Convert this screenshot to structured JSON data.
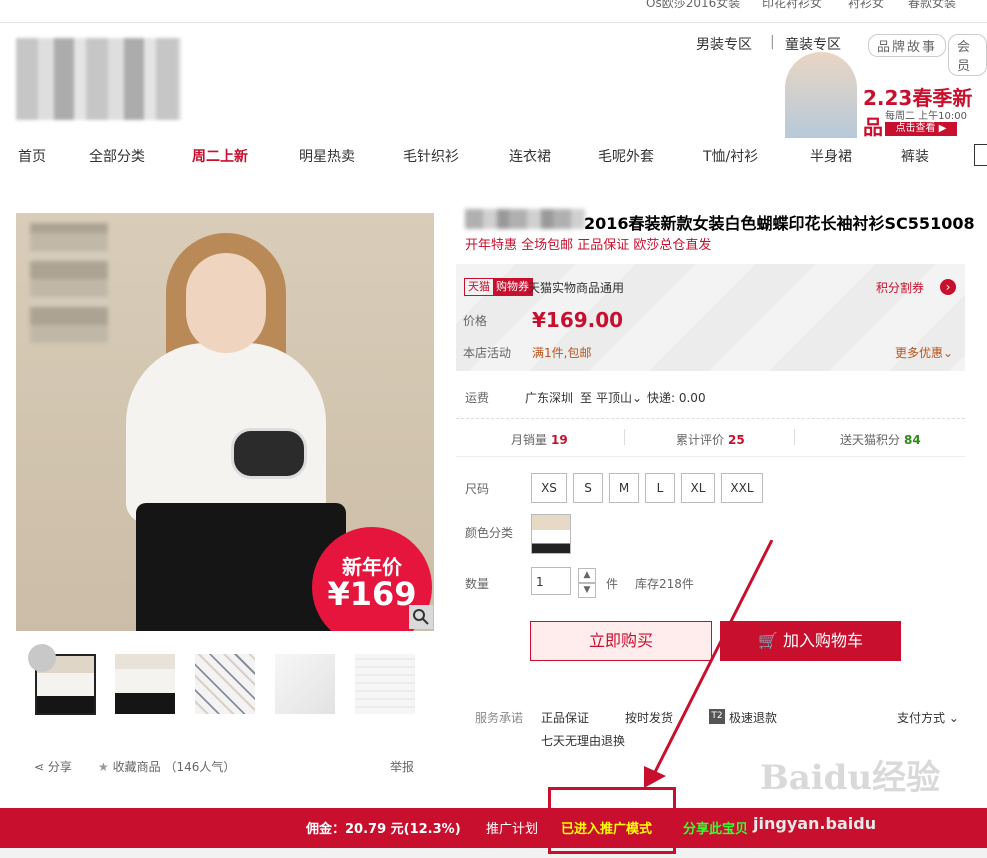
{
  "top_links": [
    "Os欧莎2016女装",
    "印花衬衫女",
    "衬衫女",
    "春款女装"
  ],
  "header": {
    "men_zone": "男装专区",
    "separator": "|",
    "kids_zone": "童装专区",
    "brand_story": "品牌故事",
    "member": "会员"
  },
  "banner": {
    "title": "2.23春季新品",
    "subtitle": "每周二 上午10:00",
    "button": "点击查看 ▶"
  },
  "nav": [
    "首页",
    "全部分类",
    "周二上新",
    "明星热卖",
    "毛针织衫",
    "连衣裙",
    "毛呢外套",
    "T恤/衬衫",
    "半身裙",
    "裤装"
  ],
  "nav_active_index": 2,
  "product": {
    "title": "2016春装新款女装白色蝴蝶印花长袖衬衫SC551008",
    "subtitle": "开年特惠 全场包邮 正品保证 欧莎总仓直发",
    "image_badge_label": "新年价",
    "image_badge_price": "¥169"
  },
  "price_panel": {
    "tmall": "天猫",
    "coupon": "购物券",
    "coupon_desc": "天猫实物商品通用",
    "points": "积分割券",
    "points_arrow": "›",
    "price_label": "价格",
    "price": "¥169.00",
    "promo_label": "本店活动",
    "promo_value": "满1件,包邮",
    "more_offers": "更多优惠"
  },
  "shipping": {
    "label": "运费",
    "from": "广东深圳",
    "to_word": "至",
    "to": "平顶山",
    "express": "快递: 0.00"
  },
  "stats": {
    "monthly_sales_label": "月销量",
    "monthly_sales": "19",
    "reviews_label": "累计评价",
    "reviews": "25",
    "points_label": "送天猫积分",
    "points": "84"
  },
  "size": {
    "label": "尺码",
    "options": [
      "XS",
      "S",
      "M",
      "L",
      "XL",
      "XXL"
    ]
  },
  "color": {
    "label": "颜色分类"
  },
  "quantity": {
    "label": "数量",
    "value": "1",
    "unit": "件",
    "stock": "库存218件",
    "up": "▲",
    "down": "▼"
  },
  "actions": {
    "buy_now": "立即购买",
    "add_to_cart": "加入购物车"
  },
  "service": {
    "label": "服务承诺",
    "items": [
      "正品保证",
      "按时发货",
      "极速退款",
      "七天无理由退换"
    ],
    "t2": "T2",
    "payment": "支付方式"
  },
  "share_row": {
    "share": "分享",
    "favorite": "收藏商品",
    "popularity": "（146人气）",
    "report": "举报"
  },
  "bottom_bar": {
    "commission": "佣金：20.79 元(12.3%)",
    "plan": "推广计划",
    "promo_mode": "已进入推广模式",
    "share_item": "分享此宝贝",
    "tail": "jingyan.baidu"
  },
  "watermark": {
    "logo": "Baidu经验",
    "url": "jingyan.baidu.com"
  },
  "colors": {
    "brand_red": "#c8102e",
    "price_red": "#c8102e",
    "stat_green": "#2e8b1a",
    "promo_yellow": "#ffff00",
    "share_green": "#33ff33"
  }
}
